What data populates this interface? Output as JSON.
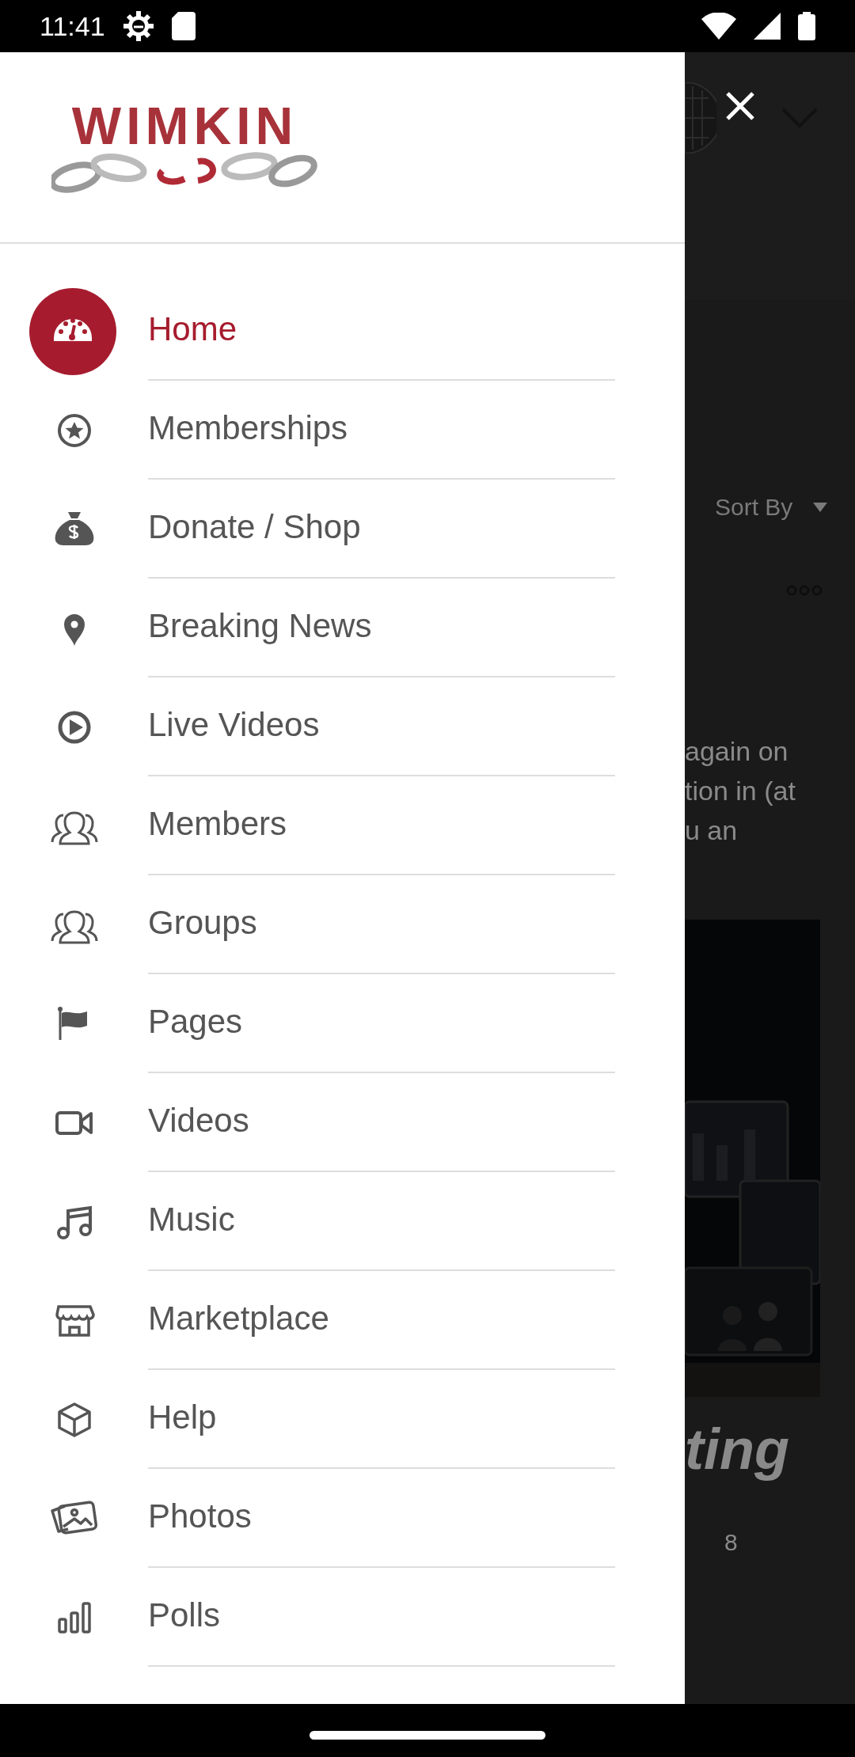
{
  "status_bar": {
    "time": "11:41"
  },
  "drawer": {
    "logo": {
      "text": "WIMKIN"
    },
    "items": [
      {
        "label": "Home",
        "selected": true
      },
      {
        "label": "Memberships",
        "selected": false
      },
      {
        "label": "Donate / Shop",
        "selected": false
      },
      {
        "label": "Breaking News",
        "selected": false
      },
      {
        "label": "Live Videos",
        "selected": false
      },
      {
        "label": "Members",
        "selected": false
      },
      {
        "label": "Groups",
        "selected": false
      },
      {
        "label": "Pages",
        "selected": false
      },
      {
        "label": "Videos",
        "selected": false
      },
      {
        "label": "Music",
        "selected": false
      },
      {
        "label": "Marketplace",
        "selected": false
      },
      {
        "label": "Help",
        "selected": false
      },
      {
        "label": "Photos",
        "selected": false
      },
      {
        "label": "Polls",
        "selected": false
      }
    ]
  },
  "background": {
    "sort_label": "Sort By",
    "text_lines": [
      "again on",
      "tion in (at",
      "u an"
    ],
    "heading": "ting",
    "count": "8"
  }
}
